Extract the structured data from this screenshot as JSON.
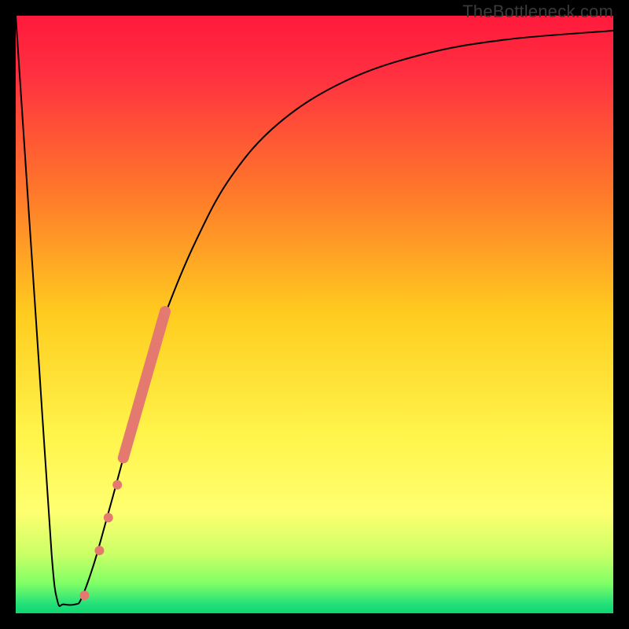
{
  "watermark": "TheBottleneck.com",
  "chart_data": {
    "type": "line",
    "title": "",
    "xlabel": "",
    "ylabel": "",
    "xlim": [
      0,
      100
    ],
    "ylim": [
      0,
      100
    ],
    "background_gradient_stops": [
      {
        "offset": 0,
        "color": "#ff1a3c"
      },
      {
        "offset": 0.1,
        "color": "#ff3040"
      },
      {
        "offset": 0.3,
        "color": "#ff7a2a"
      },
      {
        "offset": 0.5,
        "color": "#ffcc1f"
      },
      {
        "offset": 0.7,
        "color": "#fff44a"
      },
      {
        "offset": 0.83,
        "color": "#ffff70"
      },
      {
        "offset": 0.9,
        "color": "#ccff66"
      },
      {
        "offset": 0.95,
        "color": "#80ff66"
      },
      {
        "offset": 0.985,
        "color": "#22e07a"
      },
      {
        "offset": 1.0,
        "color": "#0fd670"
      }
    ],
    "series": [
      {
        "name": "main-curve",
        "stroke": "#000000",
        "stroke_width": 2,
        "points": [
          {
            "x": 0.0,
            "y": 100.0
          },
          {
            "x": 2.0,
            "y": 70.0
          },
          {
            "x": 4.0,
            "y": 40.0
          },
          {
            "x": 6.0,
            "y": 10.0
          },
          {
            "x": 7.0,
            "y": 2.0
          },
          {
            "x": 8.0,
            "y": 1.5
          },
          {
            "x": 10.0,
            "y": 1.5
          },
          {
            "x": 11.0,
            "y": 2.5
          },
          {
            "x": 13.0,
            "y": 8.0
          },
          {
            "x": 15.0,
            "y": 15.0
          },
          {
            "x": 18.0,
            "y": 26.0
          },
          {
            "x": 21.0,
            "y": 38.0
          },
          {
            "x": 25.0,
            "y": 50.0
          },
          {
            "x": 30.0,
            "y": 62.0
          },
          {
            "x": 36.0,
            "y": 73.0
          },
          {
            "x": 44.0,
            "y": 82.0
          },
          {
            "x": 55.0,
            "y": 89.0
          },
          {
            "x": 68.0,
            "y": 93.5
          },
          {
            "x": 82.0,
            "y": 96.0
          },
          {
            "x": 100.0,
            "y": 97.5
          }
        ]
      }
    ],
    "highlight_band": {
      "name": "highlight-segment",
      "color": "#e47a6f",
      "stroke_width": 14,
      "points": [
        {
          "x": 18.0,
          "y": 26.0
        },
        {
          "x": 25.0,
          "y": 50.5
        }
      ]
    },
    "markers": [
      {
        "name": "dot-1",
        "x": 11.5,
        "y": 3.0,
        "r": 6,
        "color": "#e47a6f"
      },
      {
        "name": "dot-2",
        "x": 14.0,
        "y": 10.5,
        "r": 6,
        "color": "#e47a6f"
      },
      {
        "name": "dot-3",
        "x": 15.5,
        "y": 16.0,
        "r": 6,
        "color": "#e47a6f"
      },
      {
        "name": "dot-4",
        "x": 17.0,
        "y": 21.5,
        "r": 6,
        "color": "#e47a6f"
      }
    ]
  }
}
